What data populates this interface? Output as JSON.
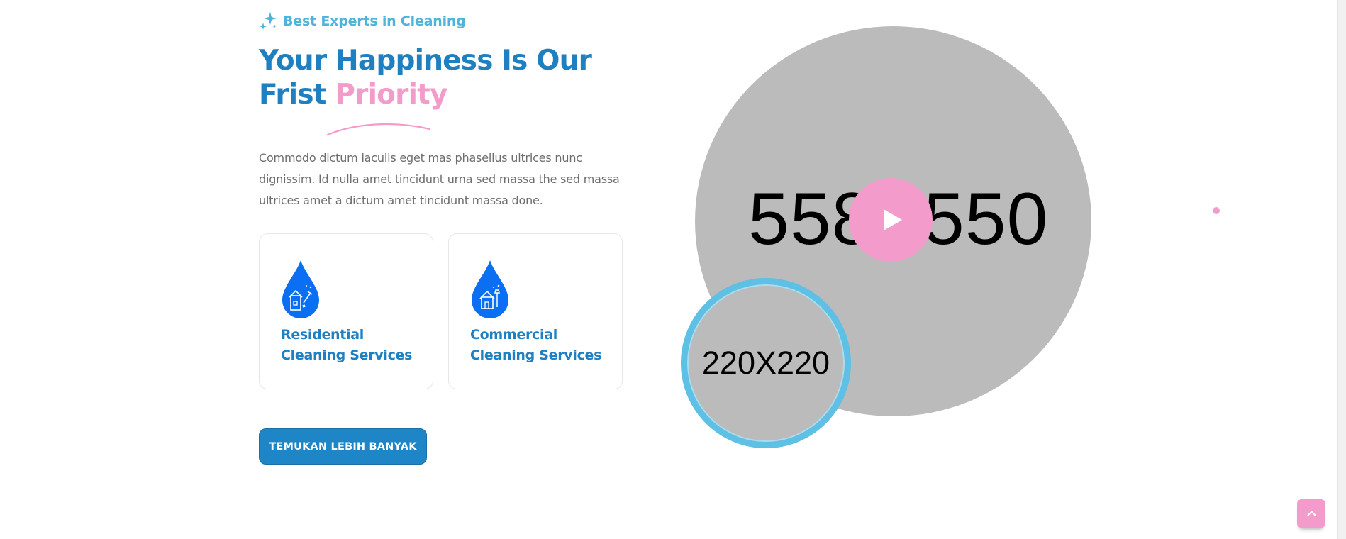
{
  "colors": {
    "primary_blue": "#1e7fc1",
    "light_blue": "#4fb3dc",
    "accent_pink": "#f39ccb",
    "drop_blue": "#0a6ff2",
    "placeholder_gray": "#bbbbbb"
  },
  "tagline": {
    "icon": "sparkle-icon",
    "text": "Best Experts in Cleaning"
  },
  "heading": {
    "line1": "Your Happiness Is Our",
    "line2_plain": "Frist",
    "line2_accent": "Priority"
  },
  "body_text": "Commodo dictum iaculis eget mas phasellus ultrices nunc dignissim. Id nulla amet tincidunt urna sed massa the sed massa ultrices amet a dictum amet tincidunt massa done.",
  "cards": [
    {
      "icon": "residential-drop-icon",
      "title_line1": "Residential",
      "title_line2": "Cleaning Services"
    },
    {
      "icon": "commercial-drop-icon",
      "title_line1": "Commercial",
      "title_line2": "Cleaning Services"
    }
  ],
  "cta_label": "TEMUKAN LEBIH BANYAK",
  "media": {
    "big_placeholder_label": "558X550",
    "small_placeholder_label": "220X220",
    "play_icon": "play-icon"
  },
  "back_to_top_icon": "chevron-up-icon"
}
